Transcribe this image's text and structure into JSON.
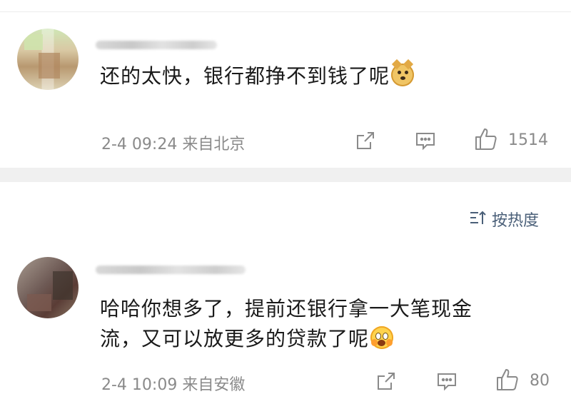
{
  "comments": [
    {
      "text": "还的太快，银行都挣不到钱了呢",
      "emoji": "doge-emoji",
      "time": "2-4 09:24",
      "location": "来自北京",
      "likes": "1514"
    },
    {
      "text": "哈哈你想多了，提前还银行拿一大笔现金\n流，又可以放更多的贷款了呢",
      "emoji": "scared-emoji",
      "time": "2-4 10:09",
      "location": "来自安徽",
      "likes": "80"
    }
  ],
  "sort": {
    "label": "按热度",
    "icon": "sort-icon"
  },
  "icons": {
    "share": "share-icon",
    "reply": "reply-icon",
    "like": "thumbs-up-icon"
  },
  "colors": {
    "meta": "#8a8a8a",
    "sort": "#4a5f78",
    "divider": "#f0f0f0"
  }
}
